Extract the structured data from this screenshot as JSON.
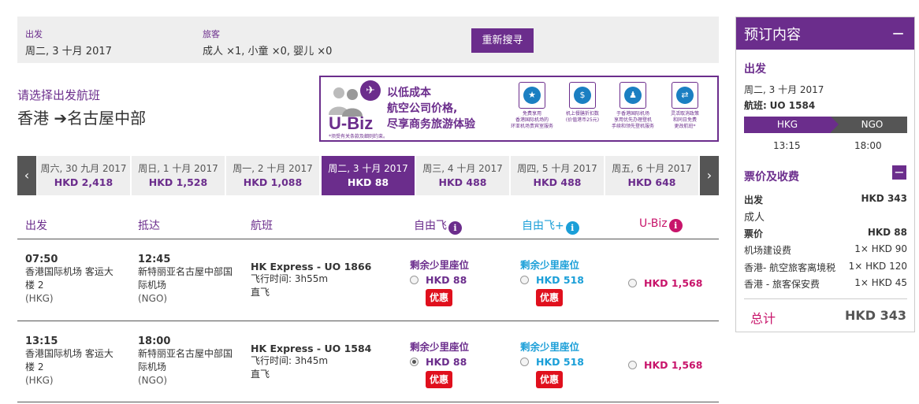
{
  "search": {
    "depart_label": "出发",
    "depart_value": "周二, 3 十月 2017",
    "pax_label": "旅客",
    "pax_value": "成人 ×1, 小童 ×0, 婴儿 ×0",
    "research_button": "重新搜寻"
  },
  "route": {
    "prompt": "请选择出发航班",
    "from": "香港",
    "to": "名古屋中部",
    "arrow": "➔"
  },
  "banner": {
    "brand": "U-Biz",
    "headline": [
      "以低成本",
      "航空公司价格,",
      "尽享商务旅游体验"
    ],
    "footnote": "*须受有关条款及细则约束。",
    "features": [
      {
        "icon": "star-person-icon",
        "glyph": "★",
        "text": [
          "免费享用",
          "香港国际机场的",
          "环亚机场贵宾室服务"
        ]
      },
      {
        "icon": "discount-cash-icon",
        "glyph": "$",
        "text": [
          "机上餐膳折扣数",
          "(价值港币25元)"
        ]
      },
      {
        "icon": "priority-checkin-icon",
        "glyph": "♟",
        "text": [
          "于香港国际机场",
          "享用优先办理登机",
          "手续和领先登机服务"
        ]
      },
      {
        "icon": "flexible-change-icon",
        "glyph": "⇄",
        "text": [
          "灵活取消政策",
          "和同日免费",
          "更改航班*"
        ]
      }
    ]
  },
  "dates": [
    {
      "label": "周六, 30 九月 2017",
      "price": "HKD 2,418"
    },
    {
      "label": "周日, 1 十月 2017",
      "price": "HKD 1,528"
    },
    {
      "label": "周一, 2 十月 2017",
      "price": "HKD 1,088"
    },
    {
      "label": "周二, 3 十月 2017",
      "price": "HKD 88"
    },
    {
      "label": "周三, 4 十月 2017",
      "price": "HKD 488"
    },
    {
      "label": "周四, 5 十月 2017",
      "price": "HKD 488"
    },
    {
      "label": "周五, 6 十月 2017",
      "price": "HKD 648"
    }
  ],
  "nav": {
    "prev": "‹",
    "next": "›"
  },
  "table": {
    "headers": {
      "depart": "出发",
      "arrive": "抵达",
      "flight": "航班",
      "fare1": "自由飞",
      "fare2": "自由飞+",
      "fare3": "U-Biz",
      "info": "i"
    },
    "rows": [
      {
        "dep_time": "07:50",
        "dep_airport": [
          "香港国际机场 客运大",
          "楼 2"
        ],
        "dep_code": "(HKG)",
        "arr_time": "12:45",
        "arr_airport": [
          "新特丽亚名古屋中部国",
          "际机场"
        ],
        "arr_code": "(NGO)",
        "flight": "HK Express - UO 1866",
        "duration_label": "飞行时间:",
        "duration": "3h55m",
        "stops": "直飞",
        "fare1_note": "剩余少里座位",
        "fare1_price": "HKD 88",
        "fare1_promo": "优惠",
        "fare2_note": "剩余少里座位",
        "fare2_price": "HKD 518",
        "fare2_promo": "优惠",
        "fare3_price": "HKD 1,568"
      },
      {
        "dep_time": "13:15",
        "dep_airport": [
          "香港国际机场 客运大",
          "楼 2"
        ],
        "dep_code": "(HKG)",
        "arr_time": "18:00",
        "arr_airport": [
          "新特丽亚名古屋中部国",
          "际机场"
        ],
        "arr_code": "(NGO)",
        "flight": "HK Express - UO 1584",
        "duration_label": "飞行时间:",
        "duration": "3h45m",
        "stops": "直飞",
        "fare1_note": "剩余少里座位",
        "fare1_price": "HKD 88",
        "fare1_promo": "优惠",
        "fare2_note": "剩余少里座位",
        "fare2_price": "HKD 518",
        "fare2_promo": "优惠",
        "fare3_price": "HKD 1,568"
      }
    ]
  },
  "sidebar": {
    "title": "预订内容",
    "collapse": "−",
    "depart_section": "出发",
    "date": "周二, 3 十月 2017",
    "flight_label": "航班:",
    "flight_no": "UO 1584",
    "from_code": "HKG",
    "to_code": "NGO",
    "dep_time": "13:15",
    "arr_time": "18:00",
    "fees_section": "票价及收费",
    "fees_toggle": "−",
    "fees": [
      {
        "label": "出发",
        "value": "HKD 343",
        "bold": true
      },
      {
        "label": "成人",
        "value": "",
        "bold": false
      },
      {
        "label": "票价",
        "value": "HKD 88",
        "bold": true
      },
      {
        "label": "机场建设费",
        "value": "1× HKD 90",
        "bold": false
      },
      {
        "label": "香港- 航空旅客离境税",
        "value": "1× HKD 120",
        "bold": false
      },
      {
        "label": "香港 - 旅客保安费",
        "value": "1× HKD 45",
        "bold": false
      }
    ],
    "total_label": "总计",
    "total_value": "HKD 343"
  },
  "colors": {
    "brand_purple": "#6b2d8c",
    "flex_plus_blue": "#1b9fd8",
    "ubiz_pink": "#c8156b",
    "promo_red": "#e0101d"
  }
}
